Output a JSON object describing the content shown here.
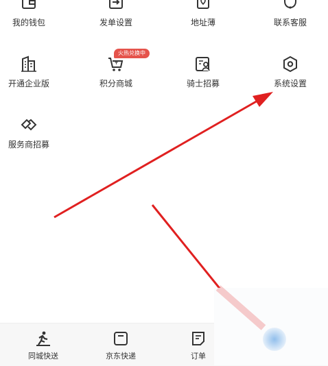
{
  "menu": {
    "row1": [
      {
        "label": "我的钱包",
        "icon": "wallet-icon"
      },
      {
        "label": "发单设置",
        "icon": "send-order-icon"
      },
      {
        "label": "地址薄",
        "icon": "address-book-icon"
      },
      {
        "label": "联系客服",
        "icon": "headset-icon"
      }
    ],
    "row2": [
      {
        "label": "开通企业版",
        "icon": "enterprise-building-icon"
      },
      {
        "label": "积分商城",
        "icon": "points-cart-icon",
        "badge": "火热兑换中"
      },
      {
        "label": "骑士招募",
        "icon": "rider-recruit-icon"
      },
      {
        "label": "系统设置",
        "icon": "settings-hexagon-icon"
      }
    ],
    "row3": [
      {
        "label": "服务商招募",
        "icon": "handshake-icon"
      }
    ]
  },
  "tabbar": [
    {
      "label": "同城快送",
      "icon": "runner-icon"
    },
    {
      "label": "京东快递",
      "icon": "package-square-icon"
    },
    {
      "label": "订单",
      "icon": "order-note-icon"
    }
  ],
  "annotation": {
    "arrow_color": "#e02020"
  }
}
